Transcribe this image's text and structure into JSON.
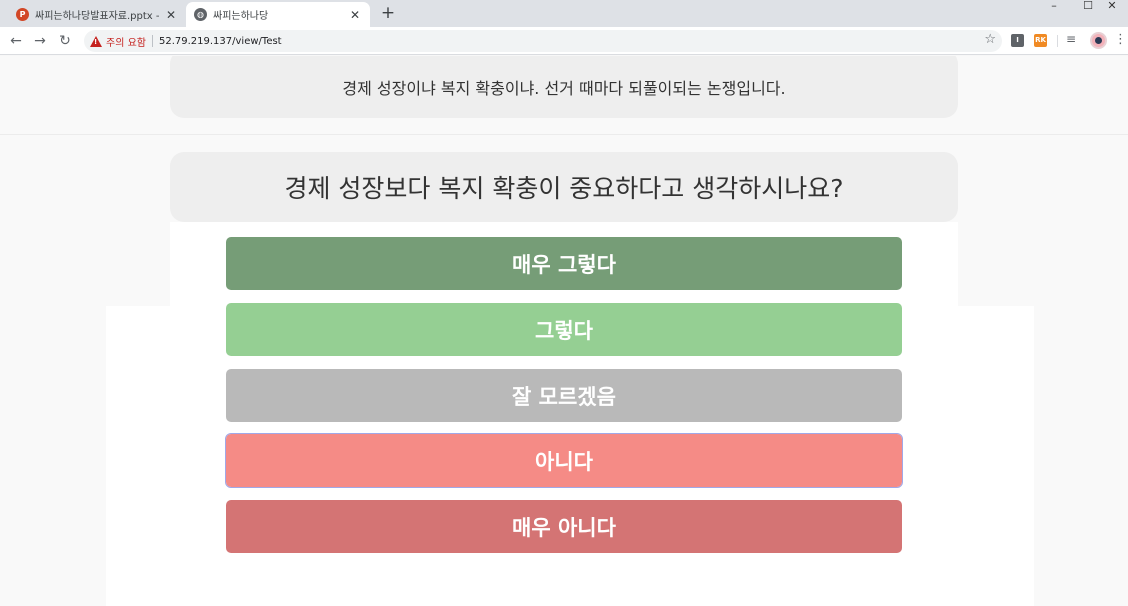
{
  "browser": {
    "tabs": [
      {
        "title": "싸피는하나당발표자료.pptx - Mi",
        "favicon": "powerpoint-icon",
        "active": false
      },
      {
        "title": "싸피는하나당",
        "favicon": "globe-icon",
        "active": true
      }
    ],
    "new_tab": "+",
    "window_controls": {
      "minimize": "–",
      "maximize": "☐",
      "close": "✕"
    },
    "security_label": "주의 요함",
    "url": "52.79.219.137/view/Test",
    "extensions": [
      {
        "label": "I",
        "color": "#5f6368"
      },
      {
        "label": "RK",
        "color": "#f08a24"
      }
    ]
  },
  "page": {
    "context_text": "경제 성장이냐 복지 확충이냐. 선거 때마다 되풀이되는 논쟁입니다.",
    "question": "경제 성장보다 복지 확충이 중요하다고 생각하시나요?",
    "answers": [
      {
        "label": "매우 그렇다",
        "color": "#769d77"
      },
      {
        "label": "그렇다",
        "color": "#95cf93"
      },
      {
        "label": "잘 모르겠음",
        "color": "#b9b9b9"
      },
      {
        "label": "아니다",
        "color": "#f58b86"
      },
      {
        "label": "매우 아니다",
        "color": "#d47474"
      }
    ]
  }
}
